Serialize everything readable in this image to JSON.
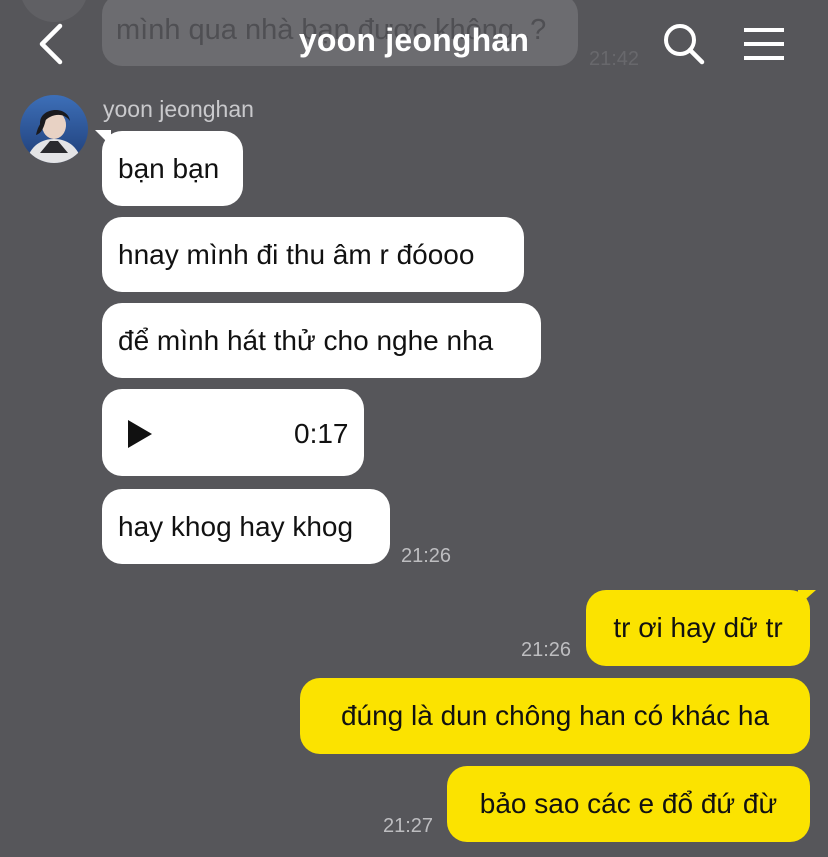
{
  "chat": {
    "title": "yoon jeonghan",
    "previous_message": {
      "text": "mình qua nhà bạn được không..?",
      "time": "21:42"
    }
  },
  "header": {
    "back_icon": "chevron-left-icon",
    "search_icon": "search-icon",
    "menu_icon": "hamburger-menu-icon"
  },
  "sender": {
    "name": "yoon jeonghan",
    "avatar_icon": "profile-photo"
  },
  "incoming": [
    {
      "text": "bạn bạn"
    },
    {
      "text": "hnay mình đi thu âm r đóooo"
    },
    {
      "text": "để mình hát thử cho nghe nha"
    },
    {
      "type": "audio",
      "duration": "0:17",
      "icon": "play-icon"
    },
    {
      "text": "hay khog hay khog",
      "time": "21:26"
    }
  ],
  "outgoing": [
    {
      "text": "tr ơi hay dữ tr",
      "time": "21:26"
    },
    {
      "text": "đúng là dun chông han có khác ha"
    },
    {
      "text": "bảo sao các e đổ đứ đừ",
      "time": "21:27"
    }
  ],
  "colors": {
    "background": "#56565a",
    "incoming_bubble": "#ffffff",
    "outgoing_bubble": "#fbe300",
    "title_text": "#ffffff",
    "timestamp": "#bdbdc0"
  }
}
